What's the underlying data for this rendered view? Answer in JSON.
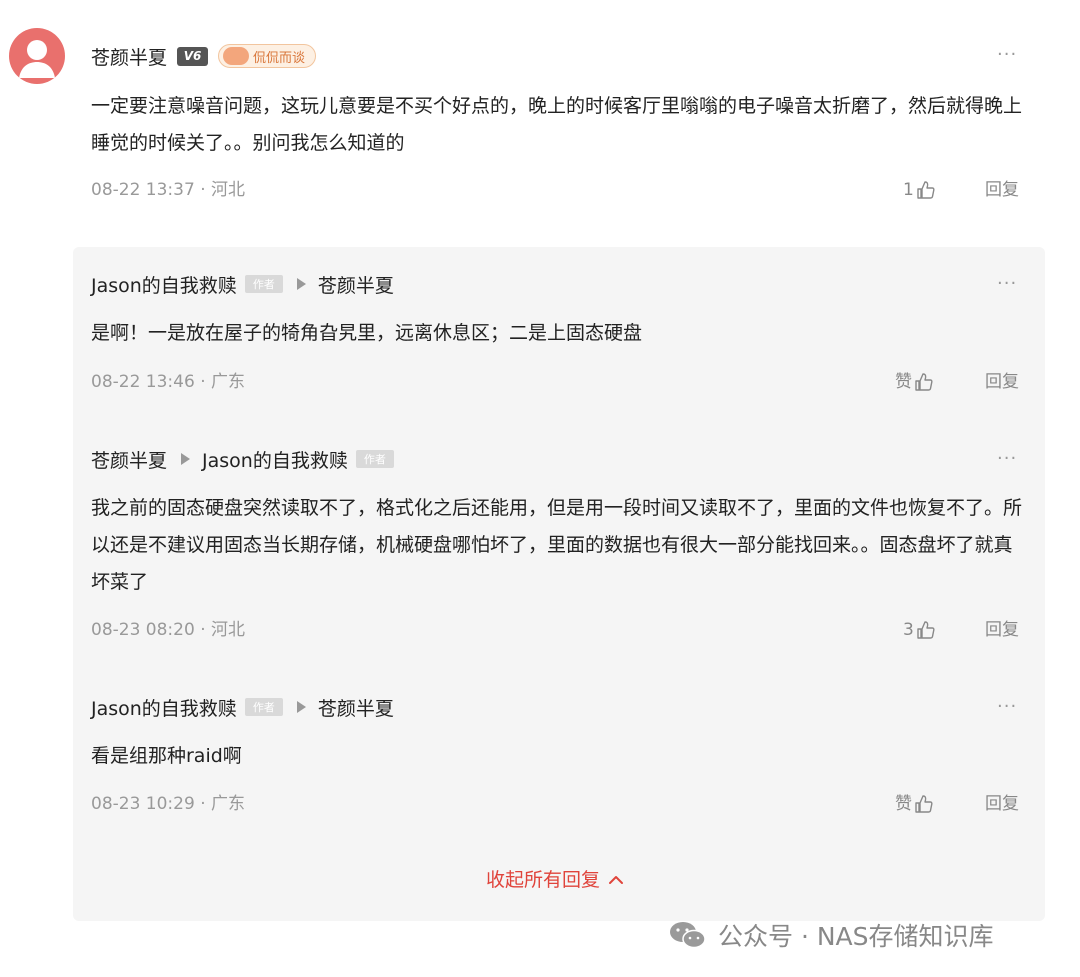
{
  "comment": {
    "author": "苍颜半夏",
    "level_badge": "V6",
    "medal": "侃侃而谈",
    "text": "一定要注意噪音问题，这玩儿意要是不买个好点的，晚上的时候客厅里嗡嗡的电子噪音太折磨了，然后就得晚上睡觉的时候关了。。别问我怎么知道的",
    "time_location": "08-22 13:37 · 河北",
    "likes": "1",
    "reply_label": "回复",
    "more": "···"
  },
  "replies": [
    {
      "from": "Jason的自我救赎",
      "from_tag": "作者",
      "to": "苍颜半夏",
      "text": "是啊！一是放在屋子的犄角旮旯里，远离休息区；二是上固态硬盘",
      "time_location": "08-22 13:46 · 广东",
      "likes": "赞",
      "reply_label": "回复",
      "more": "···"
    },
    {
      "from": "苍颜半夏",
      "to": "Jason的自我救赎",
      "to_tag": "作者",
      "text": "我之前的固态硬盘突然读取不了，格式化之后还能用，但是用一段时间又读取不了，里面的文件也恢复不了。所以还是不建议用固态当长期存储，机械硬盘哪怕坏了，里面的数据也有很大一部分能找回来。。固态盘坏了就真坏菜了",
      "time_location": "08-23 08:20 · 河北",
      "likes": "3",
      "reply_label": "回复",
      "more": "···"
    },
    {
      "from": "Jason的自我救赎",
      "from_tag": "作者",
      "to": "苍颜半夏",
      "text": "看是组那种raid啊",
      "time_location": "08-23 10:29 · 广东",
      "likes": "赞",
      "reply_label": "回复",
      "more": "···"
    }
  ],
  "collapse_label": "收起所有回复",
  "watermark": "公众号 · NAS存储知识库",
  "colors": {
    "avatar": "#e9706d",
    "accent_red": "#e0443b",
    "panel_bg": "#f5f5f5",
    "muted_text": "#999999"
  }
}
